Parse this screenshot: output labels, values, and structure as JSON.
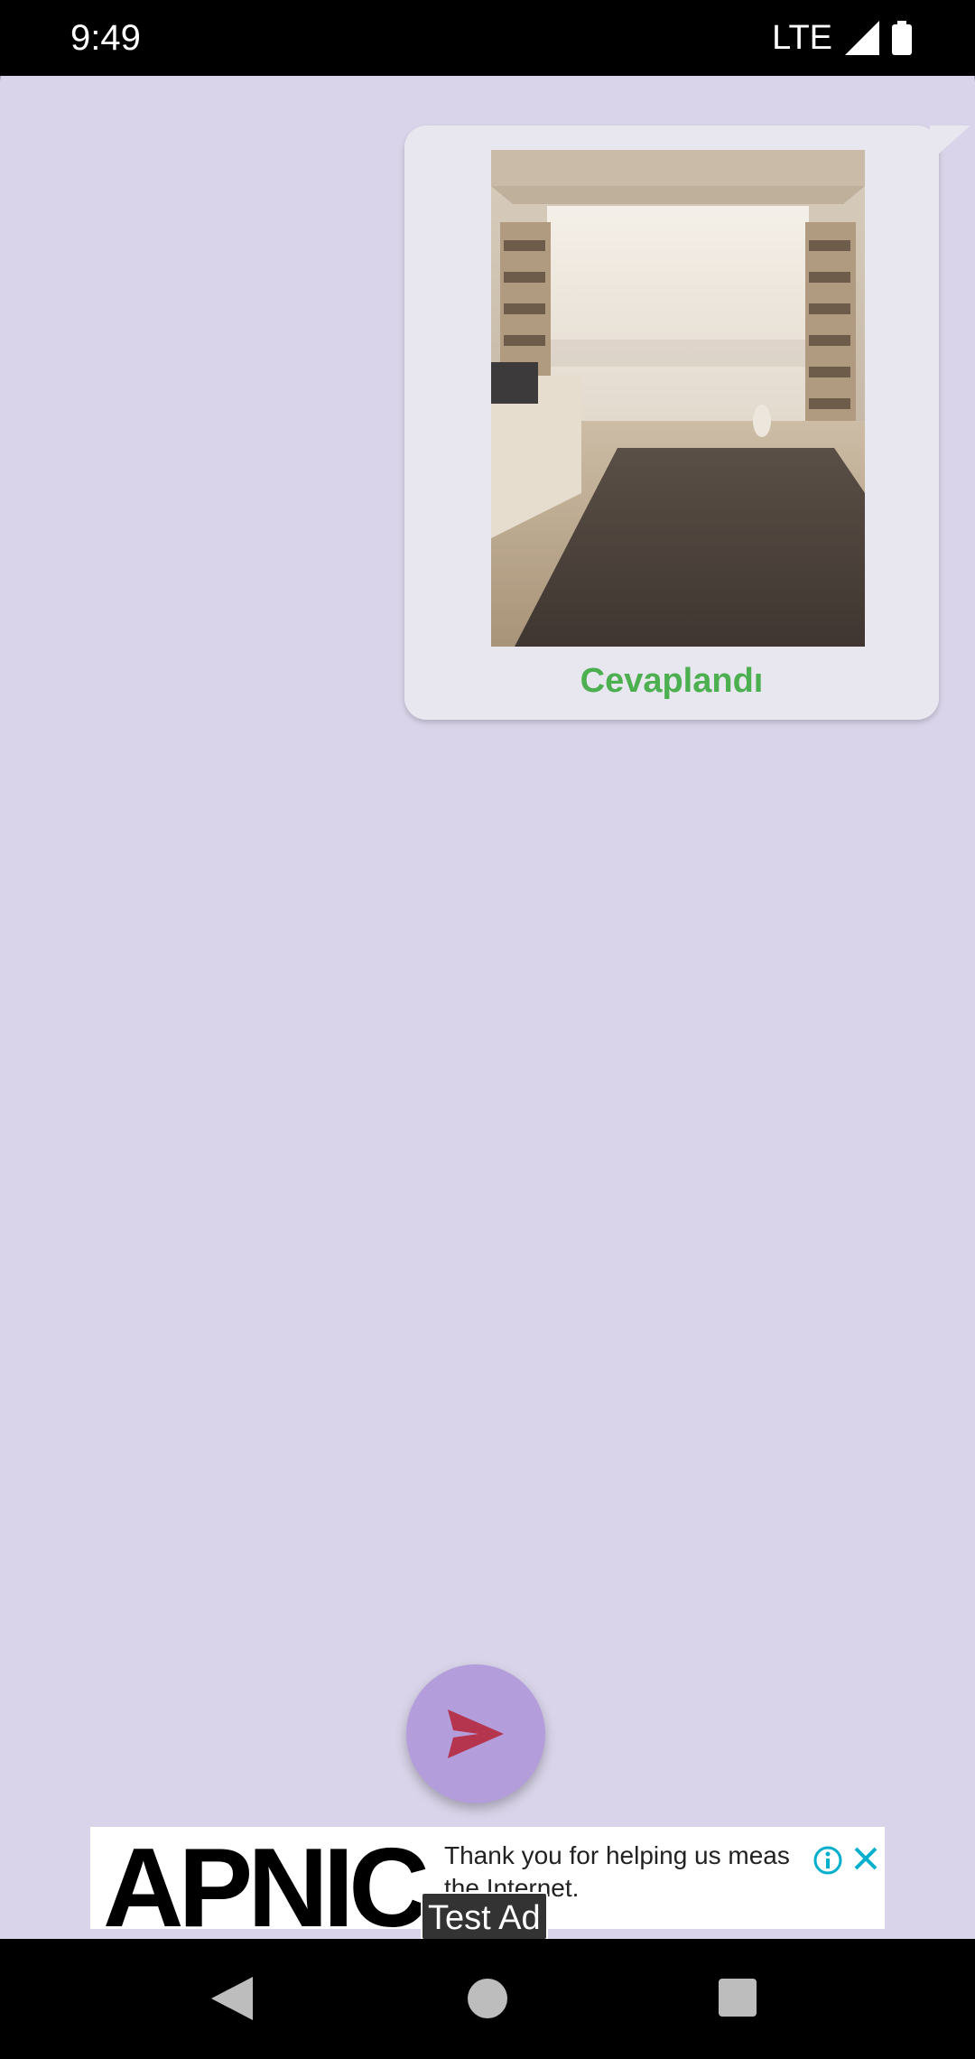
{
  "status_bar": {
    "time": "9:49",
    "network": "LTE",
    "icons": [
      "signal-icon",
      "battery-icon"
    ]
  },
  "message": {
    "image": "room-photo",
    "status_label": "Cevaplandı",
    "status_color": "#4caf50"
  },
  "fab": {
    "icon": "send-icon",
    "color": "#b39ddb"
  },
  "ad": {
    "logo_text": "APNIC",
    "text_line_1": "Thank you for helping us meas",
    "text_line_2": "the Internet.",
    "test_label": "Test Ad",
    "icons": [
      "info-icon",
      "close-icon"
    ]
  },
  "nav_bar": {
    "icons": [
      "back-icon",
      "home-icon",
      "recents-icon"
    ]
  },
  "colors": {
    "background": "#d9d4e9",
    "bubble": "#e8e6ee",
    "send_arrow": "#b5344e"
  }
}
